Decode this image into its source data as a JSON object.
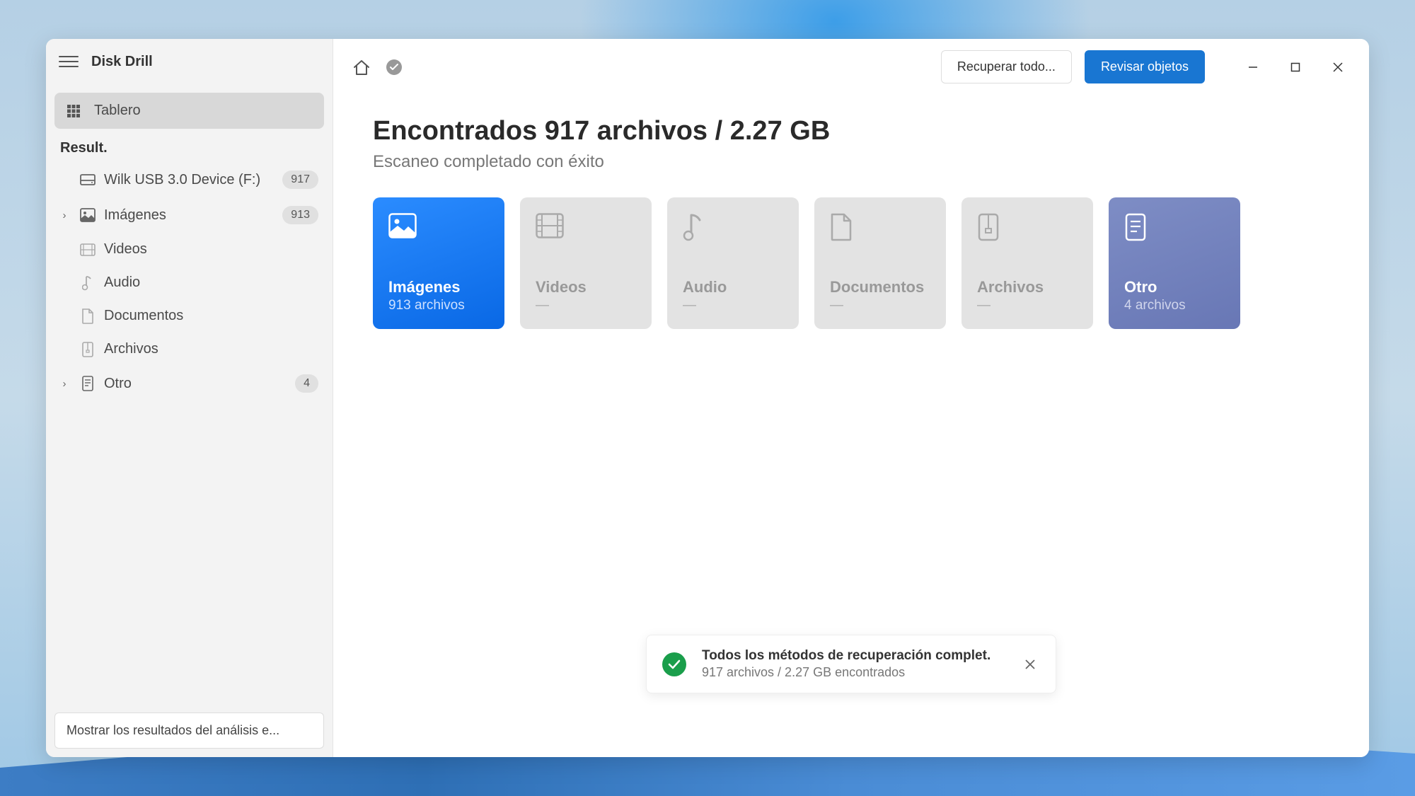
{
  "app": {
    "title": "Disk Drill"
  },
  "sidebar": {
    "dashboard_label": "Tablero",
    "results_label": "Result.",
    "device": {
      "label": "Wilk USB 3.0 Device (F:)",
      "count": "917"
    },
    "categories": [
      {
        "label": "Imágenes",
        "count": "913",
        "expandable": true
      },
      {
        "label": "Videos",
        "count": null,
        "expandable": false
      },
      {
        "label": "Audio",
        "count": null,
        "expandable": false
      },
      {
        "label": "Documentos",
        "count": null,
        "expandable": false
      },
      {
        "label": "Archivos",
        "count": null,
        "expandable": false
      },
      {
        "label": "Otro",
        "count": "4",
        "expandable": true
      }
    ],
    "footer_button": "Mostrar los resultados del análisis e..."
  },
  "topbar": {
    "recover_all": "Recuperar todo...",
    "review_objects": "Revisar objetos"
  },
  "main": {
    "title": "Encontrados 917 archivos / 2.27 GB",
    "subtitle": "Escaneo completado con éxito",
    "cards": [
      {
        "title": "Imágenes",
        "sub": "913 archivos",
        "variant": "blue"
      },
      {
        "title": "Videos",
        "sub": "—",
        "variant": "grey"
      },
      {
        "title": "Audio",
        "sub": "—",
        "variant": "grey"
      },
      {
        "title": "Documentos",
        "sub": "—",
        "variant": "grey"
      },
      {
        "title": "Archivos",
        "sub": "—",
        "variant": "grey"
      },
      {
        "title": "Otro",
        "sub": "4 archivos",
        "variant": "purple"
      }
    ]
  },
  "toast": {
    "title": "Todos los métodos de recuperación complet.",
    "subtitle": "917 archivos / 2.27 GB encontrados"
  }
}
